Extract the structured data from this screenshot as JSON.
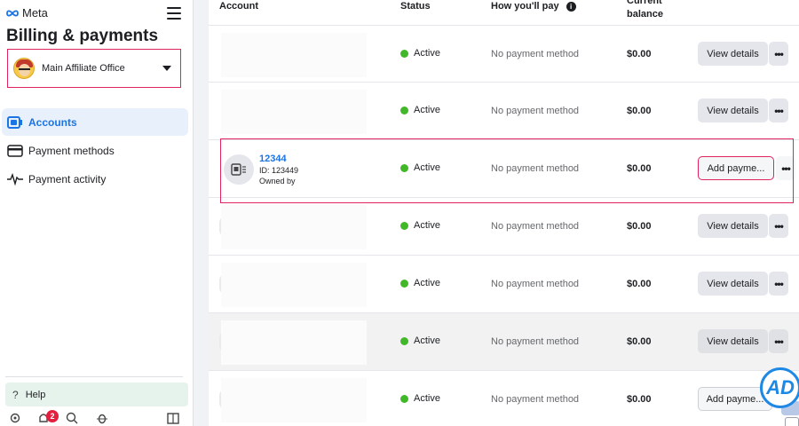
{
  "brand": {
    "logo_text": "Meta"
  },
  "sidebar": {
    "title": "Billing & payments",
    "account_selector": {
      "value": "Main Affiliate Office"
    },
    "nav": [
      {
        "label": "Accounts",
        "icon": "accounts-icon",
        "active": true
      },
      {
        "label": "Payment methods",
        "icon": "credit-card-icon",
        "active": false
      },
      {
        "label": "Payment activity",
        "icon": "activity-icon",
        "active": false
      }
    ],
    "help_label": "Help",
    "notification_count": "2"
  },
  "table": {
    "headers": {
      "account": "Account",
      "status": "Status",
      "how_youll_pay": "How you'll pay",
      "current_balance": "Current balance"
    },
    "rows": [
      {
        "account": "",
        "status": "Active",
        "payment": "No payment method",
        "balance": "$0.00",
        "action": "View details"
      },
      {
        "account": "",
        "status": "Active",
        "payment": "No payment method",
        "balance": "$0.00",
        "action": "View details"
      },
      {
        "account": "12344",
        "account_id": "ID: 123449",
        "owned_by": "Owned by",
        "status": "Active",
        "payment": "No payment method",
        "balance": "$0.00",
        "action": "Add payme..."
      },
      {
        "account": "",
        "status": "Active",
        "payment": "No payment method",
        "balance": "$0.00",
        "action": "View details"
      },
      {
        "account": "",
        "status": "Active",
        "payment": "No payment method",
        "balance": "$0.00",
        "action": "View details"
      },
      {
        "account": "",
        "status": "Active",
        "payment": "No payment method",
        "balance": "$0.00",
        "action": "View details"
      },
      {
        "account": "",
        "status": "Active",
        "payment": "No payment method",
        "balance": "$0.00",
        "action": "Add payme..."
      }
    ],
    "more_label": "•••"
  },
  "overlay": {
    "badge_text": "AD"
  },
  "colors": {
    "accent": "#1b74e4",
    "status_active": "#42b72a",
    "highlight": "#e0245e"
  }
}
